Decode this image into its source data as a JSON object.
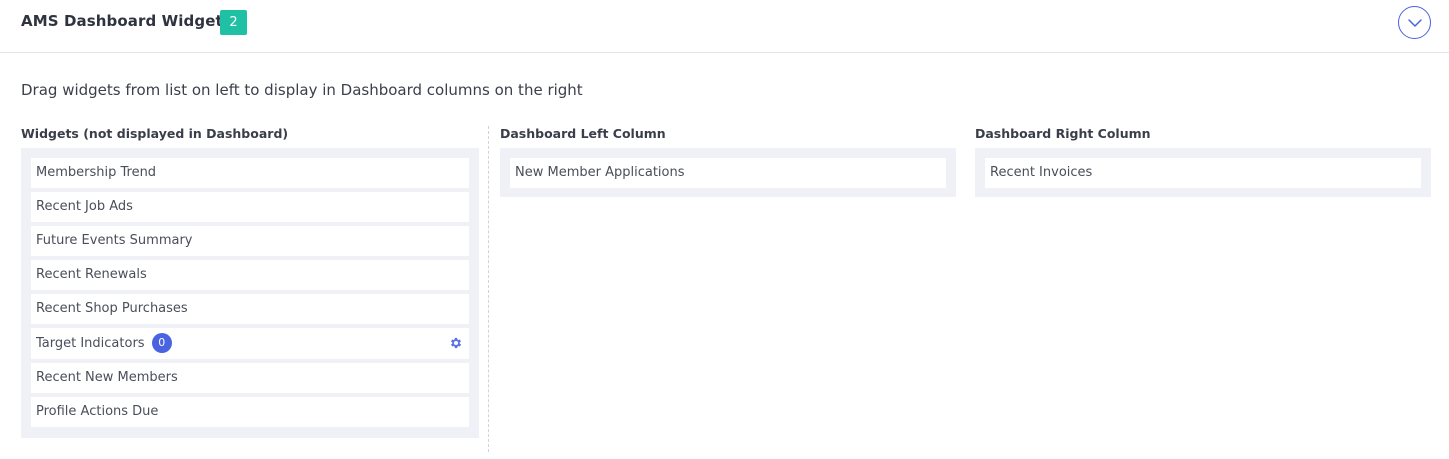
{
  "header": {
    "title": "AMS Dashboard Widgets",
    "badge": "2",
    "collapse_icon": "chevron-down-circle-icon"
  },
  "instructions": "Drag widgets from list on left to display in Dashboard columns on the right",
  "available": {
    "heading": "Widgets (not displayed in Dashboard)",
    "items": [
      "Membership Trend",
      "Recent Job Ads",
      "Future Events Summary",
      "Recent Renewals",
      "Recent Shop Purchases",
      "Target Indicators",
      "Recent New Members",
      "Profile Actions Due"
    ],
    "target_indicators_count": "0",
    "settings_icon": "gear-icon"
  },
  "left_column": {
    "heading": "Dashboard Left Column",
    "items": [
      "New Member Applications"
    ]
  },
  "right_column": {
    "heading": "Dashboard Right Column",
    "items": [
      "Recent Invoices"
    ]
  },
  "colors": {
    "accent": "#4a63e0",
    "badge": "#20c0a4",
    "column_bg": "#eff1f7"
  }
}
